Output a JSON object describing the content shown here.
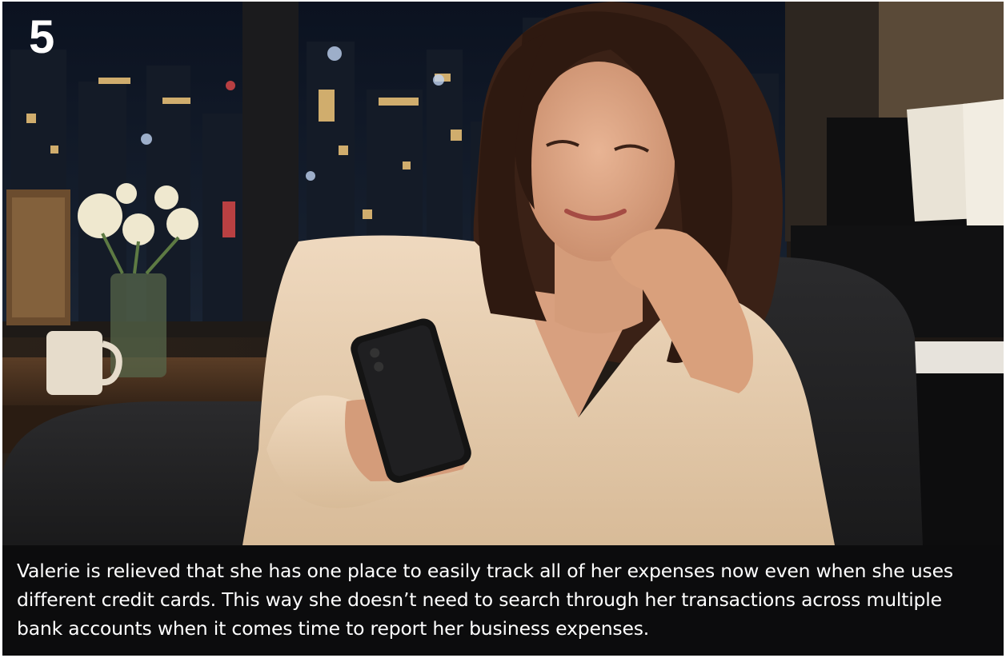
{
  "slide": {
    "step_number": "5",
    "caption": "Valerie is relieved that she has one place to easily track all of her expenses now even when she uses different credit cards. This way she doesn’t need to search through her transactions across multiple bank accounts when it comes time to report her business expenses."
  },
  "colors": {
    "caption_background": "#0c0c0d",
    "caption_text": "#ffffff",
    "step_number_text": "#ffffff"
  }
}
